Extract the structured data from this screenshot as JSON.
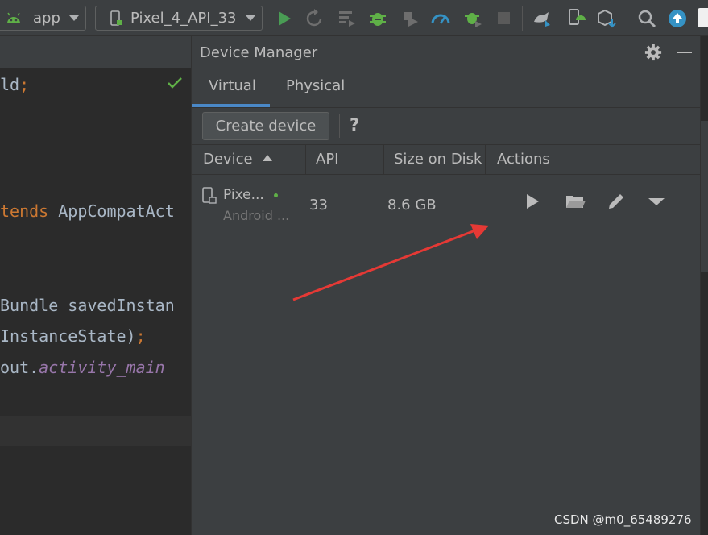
{
  "toolbar": {
    "run_config": "app",
    "device": "Pixel_4_API_33",
    "icons": [
      "android-icon",
      "phone-icon",
      "run-icon",
      "rerun-icon",
      "apply-changes-icon",
      "debug-icon",
      "attach-debugger-icon",
      "profiler-icon",
      "debug-bug-icon",
      "stop-icon",
      "sync-icon",
      "device-manager-icon",
      "sdk-manager-icon",
      "search-icon",
      "update-icon"
    ],
    "colors": {
      "run": "#499c54",
      "update": "#3592c4",
      "bg": "#3c3f41"
    }
  },
  "editor": {
    "lines": [
      {
        "a": "ld",
        "b": ";"
      },
      {
        "a": "tends",
        "b": " AppCompatAct"
      },
      {
        "a": "Bundle savedInstan"
      },
      {
        "a": "InstanceState)",
        "b": ";"
      },
      {
        "a": "out.",
        "b": "activity_main"
      }
    ]
  },
  "device_manager": {
    "title": "Device Manager",
    "tabs": [
      {
        "label": "Virtual",
        "active": true
      },
      {
        "label": "Physical",
        "active": false
      }
    ],
    "create_device_label": "Create device",
    "help_label": "?",
    "columns": [
      "Device",
      "API",
      "Size on Disk",
      "Actions"
    ],
    "rows": [
      {
        "name": "Pixe...",
        "subtitle": "Android ...",
        "api": "33",
        "size": "8.6 GB",
        "online": true,
        "actions": [
          "launch-icon",
          "folder-icon",
          "edit-icon",
          "more-dropdown-icon"
        ]
      }
    ]
  },
  "watermark": "CSDN @m0_65489276",
  "annotation_color": "#e53935"
}
